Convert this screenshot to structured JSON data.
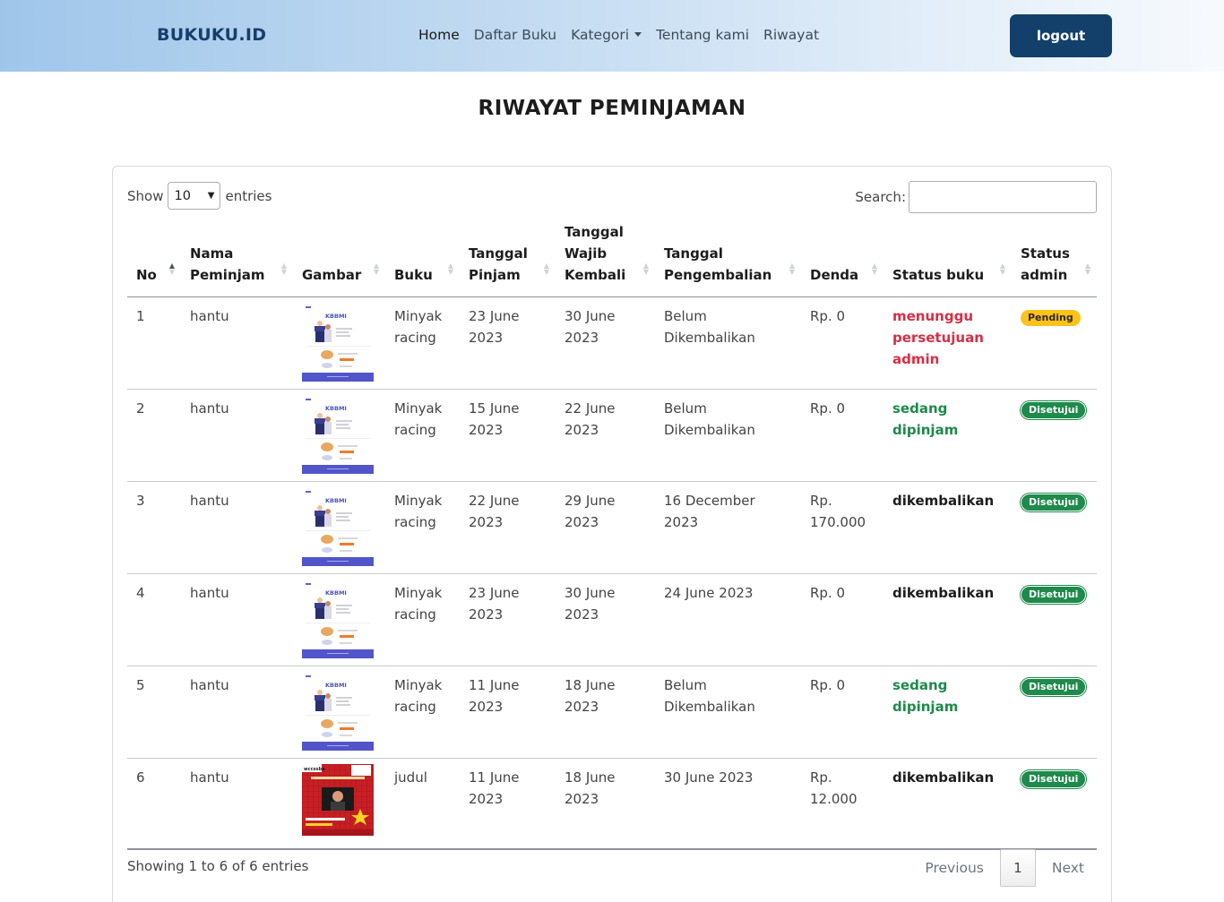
{
  "navbar": {
    "brand": "BUKUKU.ID",
    "links": [
      "Home",
      "Daftar Buku",
      "Kategori",
      "Tentang kami",
      "Riwayat"
    ],
    "logout": "logout"
  },
  "page": {
    "title": "RIWAYAT PEMINJAMAN"
  },
  "table_controls": {
    "show_label": "Show",
    "entries_value": "10",
    "entries_label": "entries",
    "search_label": "Search:",
    "search_value": ""
  },
  "columns": [
    "No",
    "Nama Peminjam",
    "Gambar",
    "Buku",
    "Tanggal Pinjam",
    "Tanggal Wajib Kembali",
    "Tanggal Pengembalian",
    "Denda",
    "Status buku",
    "Status admin"
  ],
  "rows": [
    {
      "no": "1",
      "nama": "hantu",
      "gambar": "kbbmi-cover-icon",
      "buku": "Minyak racing",
      "pinjam": "23 June 2023",
      "wajib": "30 June 2023",
      "kembali": "Belum Dikembalikan",
      "denda": "Rp. 0",
      "status_buku": "menunggu persetujuan admin",
      "status_buku_color": "#d62f45",
      "status_admin": "Pending"
    },
    {
      "no": "2",
      "nama": "hantu",
      "gambar": "kbbmi-cover-icon",
      "buku": "Minyak racing",
      "pinjam": "15 June 2023",
      "wajib": "22 June 2023",
      "kembali": "Belum Dikembalikan",
      "denda": "Rp. 0",
      "status_buku": "sedang dipinjam",
      "status_buku_color": "#1e8a4b",
      "status_admin": "Disetujui"
    },
    {
      "no": "3",
      "nama": "hantu",
      "gambar": "kbbmi-cover-icon",
      "buku": "Minyak racing",
      "pinjam": "22 June 2023",
      "wajib": "29 June 2023",
      "kembali": "16 December 2023",
      "denda": "Rp. 170.000",
      "status_buku": "dikembalikan",
      "status_buku_color": "#1d1d1d",
      "status_admin": "Disetujui"
    },
    {
      "no": "4",
      "nama": "hantu",
      "gambar": "kbbmi-cover-icon",
      "buku": "Minyak racing",
      "pinjam": "23 June 2023",
      "wajib": "30 June 2023",
      "kembali": "24 June 2023",
      "denda": "Rp. 0",
      "status_buku": "dikembalikan",
      "status_buku_color": "#1d1d1d",
      "status_admin": "Disetujui"
    },
    {
      "no": "5",
      "nama": "hantu",
      "gambar": "kbbmi-cover-icon",
      "buku": "Minyak racing",
      "pinjam": "11 June 2023",
      "wajib": "18 June 2023",
      "kembali": "Belum Dikembalikan",
      "denda": "Rp. 0",
      "status_buku": "sedang dipinjam",
      "status_buku_color": "#1e8a4b",
      "status_admin": "Disetujui"
    },
    {
      "no": "6",
      "nama": "hantu",
      "gambar": "red-poster-cover-icon",
      "buku": "judul",
      "pinjam": "11 June 2023",
      "wajib": "18 June 2023",
      "kembali": "30 June 2023",
      "denda": "Rp. 12.000",
      "status_buku": "dikembalikan",
      "status_buku_color": "#1d1d1d",
      "status_admin": "Disetujui"
    }
  ],
  "footer": {
    "info": "Showing 1 to 6 of 6 entries",
    "previous": "Previous",
    "current_page": "1",
    "next": "Next"
  },
  "colors": {
    "brand": "#173f6b",
    "logout_bg": "#133f6b",
    "pending_badge": "#fdc21a",
    "approved_badge": "#1e8a4b"
  }
}
